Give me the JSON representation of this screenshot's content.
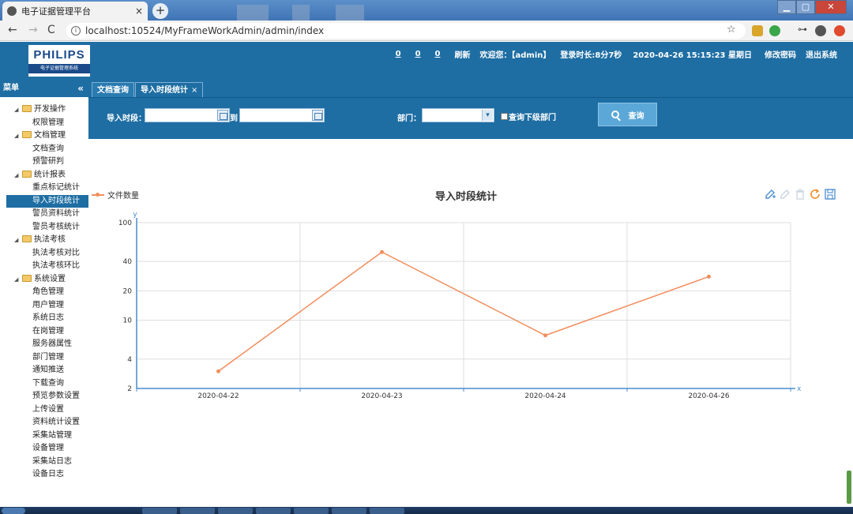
{
  "browser": {
    "tab_title": "电子证据管理平台",
    "tab_close": "×",
    "newtab_label": "+",
    "url": "localhost:10524/MyFrameWorkAdmin/admin/index",
    "back": "←",
    "forward": "→",
    "reload": "C",
    "star": "☆"
  },
  "header": {
    "logo_text": "PHILIPS",
    "logo_sub": "电子证据管理系统",
    "counts": [
      "0",
      "0",
      "0"
    ],
    "refresh": "刷新",
    "welcome": "欢迎您：【admin】",
    "login_duration": "登录时长:8分7秒",
    "datetime": "2020-04-26 15:15:23 星期日",
    "change_password": "修改密码",
    "logout": "退出系统"
  },
  "sidebar": {
    "title": "菜单",
    "collapse": "«",
    "groups": [
      {
        "label": "开发操作",
        "items": [
          "权限管理"
        ]
      },
      {
        "label": "文档管理",
        "items": [
          "文档查询",
          "预警研判"
        ]
      },
      {
        "label": "统计报表",
        "items": [
          "重点标记统计",
          "导入时段统计",
          "警员资料统计",
          "警员考核统计"
        ]
      },
      {
        "label": "执法考核",
        "items": [
          "执法考核对比",
          "执法考核环比"
        ]
      },
      {
        "label": "系统设置",
        "items": [
          "角色管理",
          "用户管理",
          "系统日志",
          "在岗管理",
          "服务器属性",
          "部门管理",
          "通知推送",
          "下载查询",
          "预览参数设置",
          "上传设置",
          "资料统计设置",
          "采集站管理",
          "设备管理",
          "采集站日志",
          "设备日志"
        ]
      }
    ],
    "active_item": "导入时段统计"
  },
  "tabs": {
    "items": [
      {
        "label": "文档查询"
      },
      {
        "label": "导入时段统计",
        "close": "×"
      }
    ]
  },
  "filter": {
    "period_label": "导入时段：",
    "to_label": "到",
    "dept_label": "部门：",
    "sub_dept_label": "查询下级部门",
    "query_button": "查询",
    "select_arrow": "▾"
  },
  "chart_data": {
    "type": "line",
    "title": "导入时段统计",
    "x": [
      "2020-04-22",
      "2020-04-23",
      "2020-04-24",
      "2020-04-26"
    ],
    "series": [
      {
        "name": "文件数量",
        "values": [
          3,
          50,
          7,
          28
        ]
      }
    ],
    "y_scale": "log",
    "ylim": [
      2,
      100
    ],
    "yticks": [
      2,
      4,
      10,
      20,
      40,
      100
    ],
    "xlabel": "x",
    "ylabel": "y",
    "grid": true,
    "legend_position": "top-left",
    "color": "#f28d5c",
    "toolbox_icons": [
      "edit-icon",
      "pencil-icon",
      "trash-icon",
      "refresh-icon",
      "save-icon"
    ]
  },
  "colors": {
    "accent": "#1e6ea3",
    "series": "#f28d5c",
    "axis": "#4a8ccf",
    "grid": "#dddddd"
  }
}
